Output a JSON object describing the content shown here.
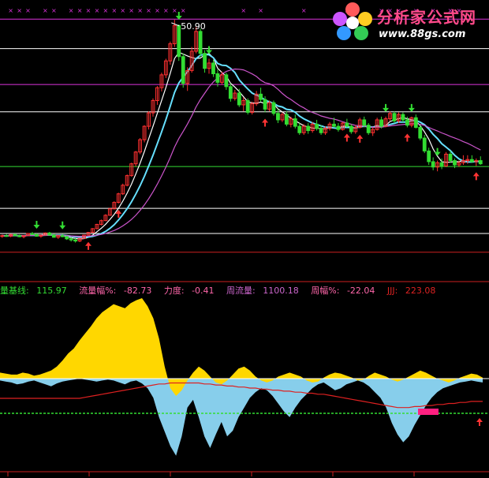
{
  "colors": {
    "background": "#000000",
    "up_candle": "#ff3030",
    "down_candle": "#33dd33",
    "ma_white": "#ffffff",
    "ma_cyan": "#66e0ff",
    "ma_violet": "#cc55cc",
    "hline_white": "#ffffff",
    "hline_magenta": "#dd33dd",
    "hline_green": "#33dd33",
    "hline_red": "#cc2020",
    "area_yellow": "#ffd700",
    "area_blue": "#87ceeb",
    "line_red": "#dd2020",
    "marker_pink": "#ff2080"
  },
  "logo": {
    "text": "分析家公式网",
    "url": "www.88gs.com"
  },
  "legend": [
    {
      "label": "量基线:",
      "value": "115.97",
      "color": "#33dd33"
    },
    {
      "label": "流量幅%:",
      "value": "-82.73",
      "color": "#ff66aa"
    },
    {
      "label": "力度:",
      "value": "-0.41",
      "color": "#ff66aa"
    },
    {
      "label": "周流量:",
      "value": "1100.18",
      "color": "#cc66cc"
    },
    {
      "label": "周幅%:",
      "value": "-22.04",
      "color": "#ff66aa"
    },
    {
      "label": "JJJ:",
      "value": "223.08",
      "color": "#dd2222"
    }
  ],
  "chart_data": {
    "type": "candlestick",
    "peak_label": "50.90",
    "candles": [
      [
        10.5,
        10.8,
        10.2,
        10.6
      ],
      [
        10.6,
        10.9,
        10.4,
        10.5
      ],
      [
        10.5,
        10.9,
        10.3,
        10.8
      ],
      [
        10.8,
        11.0,
        10.5,
        10.6
      ],
      [
        10.6,
        10.8,
        10.3,
        10.4
      ],
      [
        10.4,
        10.7,
        10.1,
        10.6
      ],
      [
        10.6,
        11.1,
        10.5,
        11.0
      ],
      [
        11.0,
        11.3,
        10.7,
        10.8
      ],
      [
        10.8,
        11.0,
        10.4,
        10.5
      ],
      [
        10.5,
        10.8,
        10.2,
        10.7
      ],
      [
        10.7,
        11.2,
        10.6,
        11.1
      ],
      [
        11.1,
        11.3,
        10.6,
        10.7
      ],
      [
        10.7,
        10.9,
        10.2,
        10.3
      ],
      [
        10.3,
        10.7,
        10.0,
        10.6
      ],
      [
        10.6,
        10.9,
        10.3,
        10.4
      ],
      [
        10.4,
        10.6,
        9.8,
        10.0
      ],
      [
        10.0,
        10.3,
        9.5,
        9.8
      ],
      [
        9.8,
        10.1,
        9.3,
        9.6
      ],
      [
        9.6,
        10.2,
        9.4,
        10.1
      ],
      [
        10.1,
        10.8,
        10.0,
        10.7
      ],
      [
        10.7,
        11.3,
        10.6,
        11.2
      ],
      [
        11.2,
        12.0,
        11.1,
        11.9
      ],
      [
        11.9,
        12.8,
        11.8,
        12.7
      ],
      [
        12.7,
        13.6,
        12.5,
        13.4
      ],
      [
        13.4,
        14.6,
        13.3,
        14.4
      ],
      [
        14.4,
        15.8,
        14.3,
        15.6
      ],
      [
        15.6,
        17.0,
        15.5,
        16.8
      ],
      [
        16.8,
        18.6,
        16.6,
        18.4
      ],
      [
        18.4,
        20.3,
        18.2,
        20.0
      ],
      [
        20.0,
        22.0,
        19.8,
        21.8
      ],
      [
        21.8,
        24.2,
        21.6,
        24.0
      ],
      [
        24.0,
        26.4,
        23.5,
        26.2
      ],
      [
        26.2,
        28.8,
        25.8,
        28.5
      ],
      [
        28.5,
        31.2,
        28.0,
        31.0
      ],
      [
        31.0,
        33.8,
        30.4,
        33.5
      ],
      [
        33.5,
        36.2,
        32.8,
        35.8
      ],
      [
        35.8,
        38.5,
        35.0,
        38.2
      ],
      [
        38.2,
        41.0,
        37.5,
        40.6
      ],
      [
        40.6,
        43.6,
        40.0,
        43.2
      ],
      [
        43.2,
        46.8,
        42.5,
        46.4
      ],
      [
        46.4,
        50.9,
        45.8,
        49.8
      ],
      [
        49.8,
        50.0,
        43.2,
        44.0
      ],
      [
        44.0,
        44.6,
        38.2,
        39.0
      ],
      [
        39.0,
        42.0,
        37.6,
        41.4
      ],
      [
        41.4,
        45.8,
        41.0,
        45.0
      ],
      [
        45.0,
        49.5,
        44.6,
        48.7
      ],
      [
        48.7,
        49.2,
        44.0,
        44.6
      ],
      [
        44.6,
        45.2,
        41.0,
        41.8
      ],
      [
        41.8,
        43.6,
        40.8,
        42.8
      ],
      [
        42.8,
        43.4,
        40.2,
        40.8
      ],
      [
        40.8,
        41.6,
        38.4,
        39.2
      ],
      [
        39.2,
        41.2,
        38.8,
        40.6
      ],
      [
        40.6,
        41.0,
        37.8,
        38.4
      ],
      [
        38.4,
        39.0,
        35.6,
        36.2
      ],
      [
        36.2,
        37.8,
        35.8,
        37.2
      ],
      [
        37.2,
        38.0,
        34.6,
        35.0
      ],
      [
        35.0,
        36.4,
        33.8,
        35.8
      ],
      [
        35.8,
        36.2,
        33.2,
        33.6
      ],
      [
        33.6,
        35.6,
        33.2,
        35.2
      ],
      [
        35.2,
        37.6,
        34.8,
        37.0
      ],
      [
        37.0,
        38.2,
        35.6,
        36.0
      ],
      [
        36.0,
        36.6,
        33.6,
        34.2
      ],
      [
        34.2,
        35.8,
        33.8,
        35.4
      ],
      [
        35.4,
        35.8,
        33.0,
        33.4
      ],
      [
        33.4,
        34.2,
        31.6,
        32.2
      ],
      [
        32.2,
        33.6,
        31.8,
        33.2
      ],
      [
        33.2,
        33.8,
        31.0,
        31.4
      ],
      [
        31.4,
        32.8,
        30.8,
        32.4
      ],
      [
        32.4,
        33.2,
        30.6,
        31.0
      ],
      [
        31.0,
        31.6,
        29.4,
        29.8
      ],
      [
        29.8,
        31.4,
        29.4,
        31.0
      ],
      [
        31.0,
        31.6,
        29.6,
        30.2
      ],
      [
        30.2,
        31.8,
        29.8,
        31.4
      ],
      [
        31.4,
        32.2,
        30.2,
        30.6
      ],
      [
        30.6,
        31.2,
        29.4,
        29.8
      ],
      [
        29.8,
        31.0,
        29.4,
        30.6
      ],
      [
        30.6,
        31.8,
        30.2,
        31.4
      ],
      [
        31.4,
        32.6,
        30.8,
        31.0
      ],
      [
        31.0,
        31.6,
        30.0,
        30.4
      ],
      [
        30.4,
        31.8,
        30.2,
        31.6
      ],
      [
        31.6,
        32.4,
        30.8,
        31.0
      ],
      [
        31.0,
        31.4,
        29.6,
        30.0
      ],
      [
        30.0,
        31.2,
        29.6,
        30.8
      ],
      [
        30.8,
        32.6,
        30.6,
        32.2
      ],
      [
        32.2,
        32.8,
        30.8,
        31.2
      ],
      [
        31.2,
        31.6,
        29.4,
        29.8
      ],
      [
        29.8,
        30.8,
        29.2,
        30.4
      ],
      [
        30.4,
        32.6,
        30.2,
        32.2
      ],
      [
        32.2,
        32.8,
        30.6,
        31.0
      ],
      [
        31.0,
        32.8,
        30.8,
        32.4
      ],
      [
        32.4,
        33.8,
        32.0,
        33.4
      ],
      [
        33.4,
        33.8,
        31.6,
        32.0
      ],
      [
        32.0,
        33.6,
        31.6,
        33.2
      ],
      [
        33.2,
        33.6,
        31.8,
        32.2
      ],
      [
        32.2,
        32.8,
        30.8,
        31.2
      ],
      [
        31.2,
        32.8,
        30.8,
        32.6
      ],
      [
        32.6,
        33.2,
        30.6,
        30.8
      ],
      [
        30.8,
        31.2,
        28.4,
        28.8
      ],
      [
        28.8,
        29.4,
        26.0,
        26.4
      ],
      [
        26.4,
        27.0,
        23.8,
        24.4
      ],
      [
        24.4,
        25.2,
        22.8,
        23.4
      ],
      [
        23.4,
        24.6,
        22.6,
        24.2
      ],
      [
        24.2,
        25.0,
        23.0,
        23.6
      ],
      [
        23.6,
        26.2,
        23.4,
        25.8
      ],
      [
        25.8,
        26.4,
        24.2,
        24.6
      ],
      [
        24.6,
        25.0,
        23.2,
        23.8
      ],
      [
        23.8,
        24.6,
        23.4,
        24.2
      ],
      [
        24.2,
        25.6,
        23.8,
        24.6
      ],
      [
        24.6,
        25.6,
        24.0,
        24.8
      ],
      [
        24.8,
        25.6,
        24.2,
        24.4
      ],
      [
        24.4,
        25.0,
        23.6,
        24.6
      ],
      [
        24.6,
        25.4,
        23.8,
        24.0
      ]
    ],
    "horizontal_levels": [
      {
        "value": 51.0,
        "color": "#dd33dd"
      },
      {
        "value": 45.5,
        "color": "#ffffff"
      },
      {
        "value": 38.8,
        "color": "#dd33dd"
      },
      {
        "value": 33.7,
        "color": "#ffffff"
      },
      {
        "value": 23.5,
        "color": "#33dd33"
      },
      {
        "value": 15.7,
        "color": "#ffffff"
      },
      {
        "value": 11.0,
        "color": "#ffffff"
      },
      {
        "value": 7.5,
        "color": "#cc2020"
      }
    ],
    "price_range": [
      6.0,
      52.5
    ],
    "buy_arrows": [
      20,
      27,
      61,
      80,
      83,
      94,
      110
    ],
    "sell_arrows": [
      8,
      14,
      41,
      48,
      89,
      95,
      101
    ],
    "flow_yellow": [
      6,
      5,
      4,
      4,
      6,
      5,
      3,
      4,
      6,
      8,
      12,
      18,
      25,
      30,
      38,
      45,
      52,
      60,
      66,
      70,
      74,
      72,
      70,
      75,
      78,
      80,
      72,
      60,
      40,
      12,
      -10,
      -18,
      -12,
      -2,
      6,
      12,
      8,
      2,
      -4,
      -6,
      -2,
      4,
      10,
      12,
      8,
      2,
      -2,
      -4,
      -2,
      2,
      4,
      6,
      4,
      2,
      -2,
      -4,
      -3,
      1,
      4,
      6,
      5,
      3,
      1,
      -2,
      -1,
      3,
      6,
      4,
      2,
      -1,
      -3,
      -1,
      2,
      5,
      8,
      6,
      3,
      0,
      -2,
      -4,
      -2,
      1,
      3,
      5,
      4,
      1
    ],
    "flow_blue": [
      -2,
      -3,
      -4,
      -6,
      -5,
      -3,
      -2,
      -4,
      -6,
      -8,
      -5,
      -3,
      -2,
      -1,
      0,
      -1,
      -2,
      -3,
      -2,
      -1,
      -2,
      -4,
      -6,
      -3,
      -2,
      -5,
      -10,
      -20,
      -40,
      -55,
      -70,
      -80,
      -60,
      -30,
      -22,
      -40,
      -60,
      -72,
      -58,
      -45,
      -60,
      -54,
      -40,
      -30,
      -20,
      -14,
      -10,
      -12,
      -18,
      -26,
      -34,
      -40,
      -30,
      -22,
      -16,
      -10,
      -6,
      -4,
      -8,
      -12,
      -10,
      -6,
      -4,
      -2,
      -4,
      -8,
      -14,
      -20,
      -30,
      -46,
      -58,
      -66,
      -60,
      -48,
      -38,
      -28,
      -20,
      -14,
      -10,
      -8,
      -6,
      -4,
      -3,
      -2,
      -3,
      -4
    ],
    "flow_red_line": [
      0,
      0,
      0,
      0,
      0,
      0,
      0,
      0,
      0,
      0,
      0,
      0,
      0,
      0,
      0,
      1,
      2,
      3,
      4,
      5,
      6,
      7,
      8,
      9,
      10,
      11,
      12,
      13,
      14,
      14,
      15,
      15,
      15,
      15,
      15,
      15,
      14,
      14,
      13,
      13,
      12,
      12,
      11,
      11,
      10,
      10,
      9,
      9,
      8,
      8,
      7,
      7,
      6,
      6,
      5,
      5,
      4,
      4,
      3,
      2,
      1,
      0,
      -1,
      -2,
      -3,
      -4,
      -5,
      -6,
      -7,
      -8,
      -9,
      -9,
      -9,
      -8,
      -8,
      -7,
      -7,
      -6,
      -6,
      -5,
      -5,
      -4,
      -4,
      -3,
      -3,
      -3
    ],
    "flow_range": [
      -90,
      80
    ]
  }
}
